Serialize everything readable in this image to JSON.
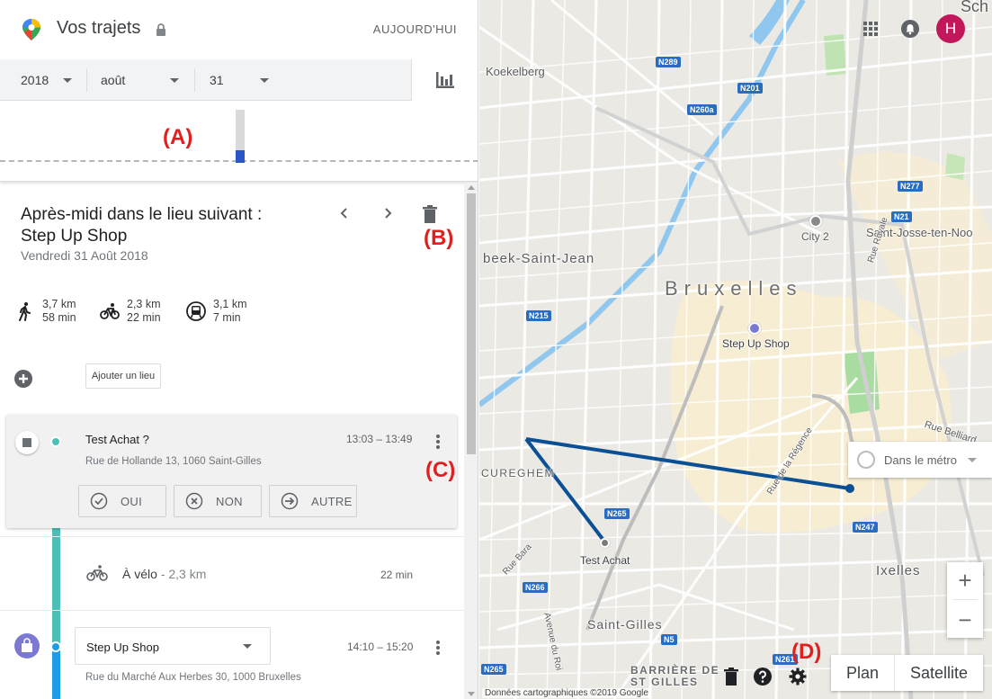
{
  "header": {
    "title": "Vos trajets",
    "today_label": "AUJOURD'HUI",
    "icons": [
      "google-maps-logo",
      "lock-icon"
    ]
  },
  "date_picker": {
    "year": "2018",
    "month": "août",
    "day": "31",
    "stats_icon": "bar-chart-icon"
  },
  "annotations": {
    "a": "(A)",
    "b": "(B)",
    "c": "(C)",
    "d": "(D)",
    "color": "#e02020"
  },
  "place_header": {
    "heading_line1": "Après-midi dans le lieu suivant :",
    "heading_line2": "Step Up Shop",
    "date": "Vendredi 31 Août 2018"
  },
  "travel_modes": [
    {
      "mode": "walk-icon",
      "distance": "3,7 km",
      "duration": "58 min"
    },
    {
      "mode": "bike-icon",
      "distance": "2,3 km",
      "duration": "22 min"
    },
    {
      "mode": "transit-icon",
      "distance": "3,1 km",
      "duration": "7 min"
    }
  ],
  "add_place": {
    "label": "Ajouter un lieu"
  },
  "visit_card": {
    "title": "Test Achat ?",
    "time": "13:03 – 13:49",
    "address": "Rue de Hollande 13, 1060 Saint-Gilles",
    "buttons": [
      {
        "label": "OUI",
        "icon": "check-circle-icon"
      },
      {
        "label": "NON",
        "icon": "x-circle-icon"
      },
      {
        "label": "AUTRE",
        "icon": "arrow-circle-icon"
      }
    ]
  },
  "activity": {
    "label": "À vélo",
    "distance": "- 2,3 km",
    "duration": "22 min"
  },
  "shop_visit": {
    "name": "Step Up Shop",
    "time": "14:10 – 15:20",
    "address": "Rue du Marché Aux Herbes 30, 1000 Bruxelles"
  },
  "map": {
    "labels": {
      "koekelberg": "Koekelberg",
      "molenbeek": "beek-Saint-Jean",
      "bruxelles": "Bruxelles",
      "st_josse": "Saint-Josse-ten-Noo",
      "city2": "City 2",
      "step_up": "Step Up Shop",
      "cureghem": "CUREGHEM",
      "test_achat": "Test Achat",
      "ixelles": "Ixelles",
      "saint_gilles": "Saint-Gilles",
      "barriere_1": "BARRIÈRE DE",
      "barriere_2": "ST GILLES",
      "rue_royale": "Rue Royale",
      "rue_belliard": "Rue Belliard",
      "rue_regence": "Rue de la Régence",
      "rue_bara": "Rue Bara",
      "av_roi": "Avenue du Roi",
      "sch": "Sch"
    },
    "road_shields": [
      "N289",
      "N201",
      "N260a",
      "N277",
      "N21",
      "N215",
      "N265",
      "N247",
      "N266",
      "N5",
      "N265",
      "N261"
    ],
    "transit_chip": "Dans le métro",
    "zoom_in": "+",
    "zoom_out": "−",
    "map_type": {
      "plan": "Plan",
      "satellite": "Satellite"
    },
    "credit": "Données cartographiques ©2019 Google",
    "avatar_letter": "H",
    "route_color": "#0b4f94"
  }
}
